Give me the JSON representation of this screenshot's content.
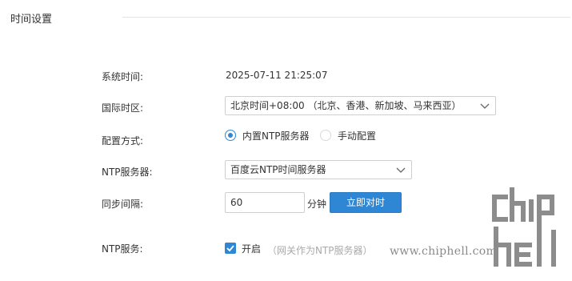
{
  "section": {
    "title": "时间设置"
  },
  "rows": {
    "system_time": {
      "label": "系统时间:",
      "value": "2025-07-11 21:25:07"
    },
    "timezone": {
      "label": "国际时区:",
      "selected": "北京时间+08:00 （北京、香港、新加坡、马来西亚）"
    },
    "config_mode": {
      "label": "配置方式:",
      "options": [
        {
          "label": "内置NTP服务器",
          "checked": true
        },
        {
          "label": "手动配置",
          "checked": false
        }
      ]
    },
    "ntp_server": {
      "label": "NTP服务器:",
      "selected": "百度云NTP时间服务器"
    },
    "sync_interval": {
      "label": "同步间隔:",
      "value": "60",
      "unit": "分钟",
      "sync_button": "立即对时"
    },
    "ntp_service": {
      "label": "NTP服务:",
      "checkbox_label": "开启",
      "checked": true,
      "hint": "（网关作为NTP服务器）"
    }
  },
  "watermark": {
    "url": "www.chiphell.com",
    "logo_text": "chip hell"
  },
  "colors": {
    "accent": "#2f86d4",
    "text": "#333333",
    "muted": "#aaaaaa",
    "border": "#cfcfcf"
  }
}
